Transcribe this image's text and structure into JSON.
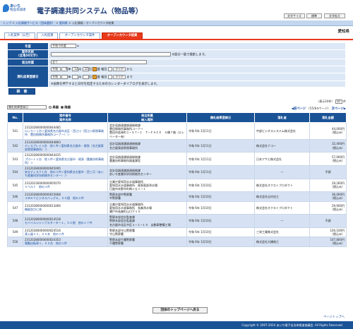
{
  "header": {
    "logo_line1": "あいち",
    "logo_line2": "物品等調達",
    "system_title": "電子調達共同システム（物品等）",
    "font_size_label": "文字サイズ",
    "font_standard": "標準",
    "font_large": "文字拡大"
  },
  "breadcrumb": {
    "items": [
      "トップ",
      "入札情報サービス（団体選択）",
      "愛知県",
      "入札情報・オープンカウンタ結果"
    ],
    "separator": " > "
  },
  "prefecture": "愛知県",
  "tabs": [
    {
      "label": "入札案件（公告）",
      "active": false
    },
    {
      "label": "入札結果",
      "active": false
    },
    {
      "label": "オープンカウンタ案件",
      "active": false
    },
    {
      "label": "オープンカウンタ結果",
      "active": true
    }
  ],
  "form": {
    "year_label": "年度",
    "year_value": "令和 6年度",
    "case_name_label": "案件名称",
    "case_name_sub": "(全角50文字)",
    "case_name_hint": "※部分一致で検索します。",
    "orderer_label": "発注所属",
    "orderer_value": "全て",
    "date_label": "開札結果登録日",
    "era": "令和",
    "year_unit": "年",
    "month_unit": "月",
    "day_unit": "日",
    "cal_label": "暦",
    "weekday_label": "曜日",
    "clear_label": "クリア",
    "from_label": "から",
    "to_label": "まで",
    "date_from": {
      "year": "6",
      "month": "12",
      "day": "22"
    },
    "date_to": {
      "year": "",
      "month": "",
      "day": ""
    },
    "date_note": "※画像を押下すると日付を指定するためのカレンダーダイアログを表示します。",
    "search_button": "検　索"
  },
  "list": {
    "sort_value": "開札結果登録日",
    "asc_label": "昇順",
    "desc_label": "降順",
    "count_text": "（表示10件）",
    "per_page_value": "10",
    "per_page_unit": "件",
    "prev_label": "前ページ",
    "page_info": "（55/64ページ）",
    "next_label": "次ページ"
  },
  "table": {
    "headers": {
      "no": "No.",
      "case": "案件番号\n案件名称",
      "orderer": "発注所属\n納入場所",
      "date": "開札結果登録日",
      "winner": "落札者",
      "amount": "落札金額"
    },
    "rows": [
      {
        "no": "541",
        "case_no": "23120280000000044485",
        "case_name": "ロッカー１台＜愛知県名古屋市北区・西江川（西江川県税事務所　豊田税務所事務所コーナー）＞",
        "orderer": "会計局調達課調達総務課",
        "place": "豊田税務所事務所コーナー\n豊田市若林町１−５７−１　Ｔ−ＦＡＣＥ　Ａ棟７階（エレベーター有）",
        "date": "令和 6年 1月11日",
        "winner": "中部ビジネスシステム株式会社",
        "amount": "44,000円",
        "amount_note": "（税込み）"
      },
      {
        "no": "542",
        "case_no": "23120280000000044893",
        "case_name": "ディスプレイ３台　他１件＜愛知県名古屋市・尾張（名古屋東部県税事務所）＞",
        "orderer": "会計局調達課調達総務課",
        "place": "名古屋東部県税事務所",
        "date": "令和 6年 1月11日",
        "winner": "株式会社ナコー",
        "amount": "32,400円",
        "amount_note": "（税込み）"
      },
      {
        "no": "543",
        "case_no": "23120280000000044435",
        "case_name": "プロート１台　他１件＜愛知県名古屋市・尾張（農業技術事務所）＞",
        "orderer": "会計局調達課調達総務課",
        "place": "農業技術事務所調査課室",
        "date": "令和 6年 1月11日",
        "winner": "日本アサヒ株式会社",
        "amount": "57,900円",
        "amount_note": "（税込み）"
      },
      {
        "no": "544",
        "case_no": "23120280000000045095",
        "case_name": "安全ディスク１台　他の３件＜愛知県名古屋市・西三河（あいち産業科学技術総合センター）＞",
        "orderer": "会計局調達課調達総務課",
        "place": "あいち産業科学技術総合センター",
        "date": "令和 6年 1月11日",
        "winner": "---",
        "amount": "不調",
        "amount_note": ""
      },
      {
        "no": "545",
        "case_no": "23120230000000005070",
        "case_name": "Ｖベルト　他の３件",
        "orderer": "企業庁愛知用水水道事務所",
        "place": "愛知用水水道事務所　尾張東部浄水場\n日進市米野木町梅ヶ丘１−１",
        "date": "令和 6年 1月10日",
        "winner": "株式会社ネクストプロダクト",
        "amount": "29,260円",
        "amount_note": "（税込み）"
      },
      {
        "no": "546",
        "case_no": "23120280000000015668",
        "case_name": "３ＷＡＹビジネスバッグ６，００個　他の２件",
        "orderer": "警察本部中警察署",
        "place": "中警察署",
        "date": "令和 6年 1月10日",
        "winner": "株式会社吉村化工",
        "amount": "36,000円",
        "amount_note": "（税込み）"
      },
      {
        "no": "547",
        "case_no": "23120280000000013466",
        "case_name": "機器並びに体",
        "orderer": "企業庁愛知用水水道事務所",
        "place": "愛知用水水道事務所　長森浄水場\n瀬戸市長森町山口下１０",
        "date": "令和 6年 1月10日",
        "winner": "株式会社ネクストプロダクト",
        "amount": "29,900円",
        "amount_note": "（税込み）"
      },
      {
        "no": "548",
        "case_no": "23120280000000014518",
        "case_name": "モバイルジャンプスターター１，００個　他の１７件",
        "orderer": "警察本部会計監査課",
        "place": "警察本部会計監査課\n名古屋市北区中区３−１−１５　自動車整備工場",
        "date": "令和 6年 1月10日",
        "winner": "---",
        "amount": "不調",
        "amount_note": ""
      },
      {
        "no": "549",
        "case_no": "23120280000000024516",
        "case_name": "蒸火器３２，００本　他の１件",
        "orderer": "警察本部守山警察署",
        "place": "守山警察署",
        "date": "令和 6年 1月10日",
        "winner": "三栄工業株式会社",
        "amount": "100,100円",
        "amount_note": "（税込み）"
      },
      {
        "no": "550",
        "case_no": "23120280000000024353",
        "case_name": "電動自転車１，００台　他の１件",
        "orderer": "警察本部千種警察署",
        "place": "千種警察署",
        "date": "令和 6年 1月10日",
        "winner": "株式会社大橋商工",
        "amount": "107,800円",
        "amount_note": "（税込み）"
      }
    ]
  },
  "bottom": {
    "top_button": "団体のトップページへ戻る",
    "page_top": "ページトップへ",
    "copyright": "Copyright © 2007-2024 あいち電子自治体推進協議会. All Rights Reserved."
  }
}
